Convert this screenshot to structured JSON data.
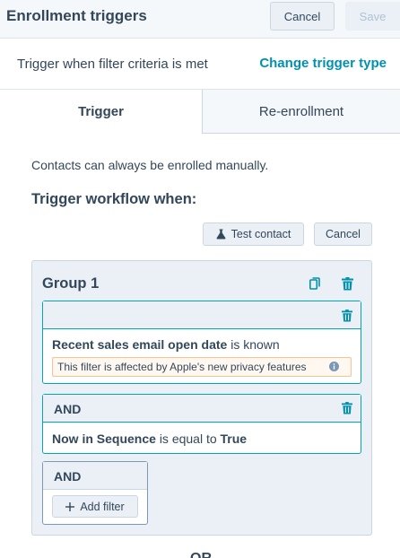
{
  "header": {
    "title": "Enrollment triggers",
    "cancel_label": "Cancel",
    "save_label": "Save"
  },
  "trigger_row": {
    "text": "Trigger when filter criteria is met",
    "change_link": "Change trigger type"
  },
  "tabs": [
    {
      "label": "Trigger",
      "active": true
    },
    {
      "label": "Re-enrollment",
      "active": false
    }
  ],
  "main": {
    "manual_note": "Contacts can always be enrolled manually.",
    "section_title": "Trigger workflow when:",
    "test_contact_label": "Test contact",
    "test_icon": "flask-icon",
    "cancel_label": "Cancel"
  },
  "group": {
    "title": "Group 1",
    "filters": [
      {
        "property": "Recent sales email open date",
        "operator": "is known",
        "value": "",
        "note": "This filter is affected by Apple's new privacy features"
      },
      {
        "connector": "AND",
        "property": "Now in Sequence",
        "operator": "is equal to",
        "value": "True"
      }
    ],
    "add_block": {
      "connector": "AND",
      "add_filter_label": "Add filter"
    }
  },
  "or_label": "OR",
  "colors": {
    "accent": "#0091ae",
    "card_border": "#00a4bd",
    "text": "#33475b",
    "panel": "#eaf0f6"
  }
}
